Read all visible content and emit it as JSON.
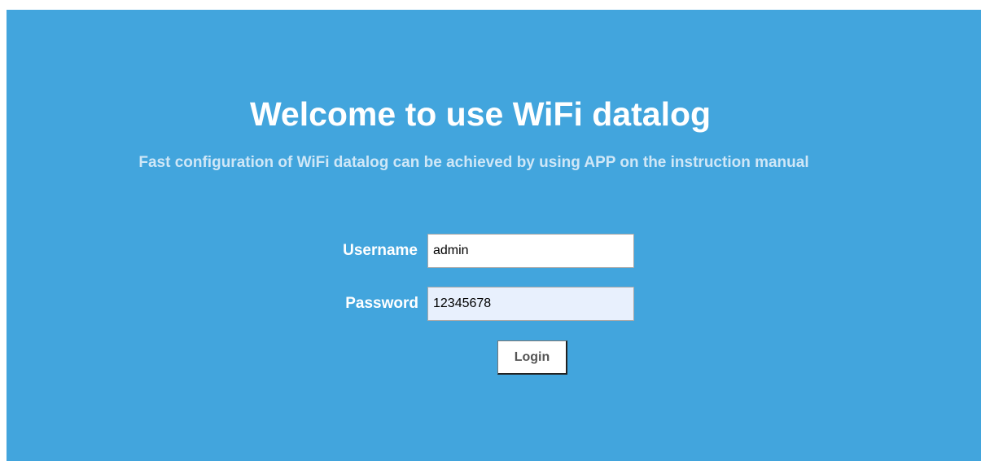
{
  "header": {
    "title": "Welcome to use WiFi datalog",
    "subtitle": "Fast configuration of WiFi datalog can be achieved by using APP on the instruction manual"
  },
  "login_form": {
    "username_label": "Username",
    "username_value": "admin",
    "password_label": "Password",
    "password_value": "12345678",
    "login_button": "Login"
  },
  "colors": {
    "panel_background": "#42a5dd",
    "title_text": "#ffffff",
    "subtitle_text": "#cfe7f7",
    "autofill_field": "#e8f0fd"
  }
}
